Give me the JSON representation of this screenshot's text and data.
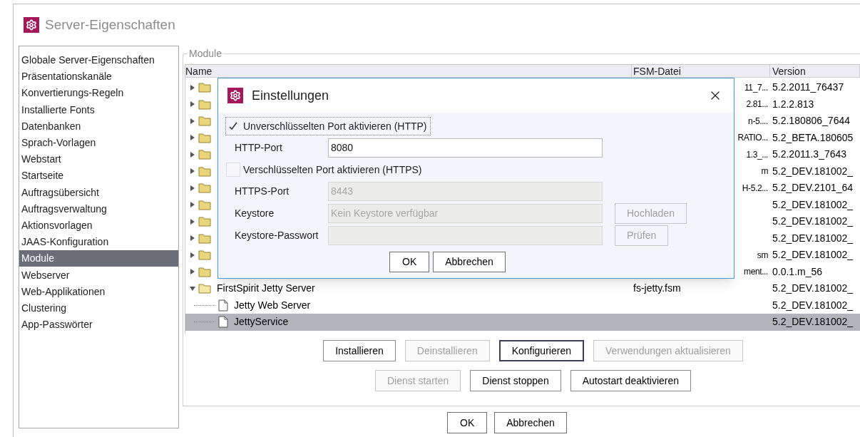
{
  "window": {
    "title": "Server-Eigenschaften"
  },
  "sidebar": {
    "items": [
      {
        "label": "Globale Server-Eigenschaften",
        "selected": false
      },
      {
        "label": "Präsentationskanäle",
        "selected": false
      },
      {
        "label": "Konvertierungs-Regeln",
        "selected": false
      },
      {
        "label": "Installierte Fonts",
        "selected": false
      },
      {
        "label": "Datenbanken",
        "selected": false
      },
      {
        "label": "Sprach-Vorlagen",
        "selected": false
      },
      {
        "label": "Webstart",
        "selected": false
      },
      {
        "label": "Startseite",
        "selected": false
      },
      {
        "label": "Auftragsübersicht",
        "selected": false
      },
      {
        "label": "Auftragsverwaltung",
        "selected": false
      },
      {
        "label": "Aktionsvorlagen",
        "selected": false
      },
      {
        "label": "JAAS-Konfiguration",
        "selected": false
      },
      {
        "label": "Module",
        "selected": true
      },
      {
        "label": "Webserver",
        "selected": false
      },
      {
        "label": "Web-Applikationen",
        "selected": false
      },
      {
        "label": "Clustering",
        "selected": false
      },
      {
        "label": "App-Passwörter",
        "selected": false
      }
    ]
  },
  "module_group": {
    "title": "Module",
    "table": {
      "columns": [
        "Name",
        "FSM-Datei",
        "Version"
      ],
      "rows": [
        {
          "kind": "folder",
          "expanded": false,
          "selected": false,
          "fsm": "11_7...",
          "version": "5.2.2011_76437"
        },
        {
          "kind": "folder",
          "expanded": false,
          "selected": false,
          "fsm": "2.81...",
          "version": "1.2.2.813"
        },
        {
          "kind": "folder",
          "expanded": false,
          "selected": false,
          "fsm": "n-5....",
          "version": "5.2.180806_7644"
        },
        {
          "kind": "folder",
          "expanded": false,
          "selected": false,
          "fsm": "RATIO...",
          "version": "5.2_BETA.180605"
        },
        {
          "kind": "folder",
          "expanded": false,
          "selected": false,
          "fsm": "1.3_...",
          "version": "5.2.2011.3_7643"
        },
        {
          "kind": "folder",
          "expanded": false,
          "selected": false,
          "fsm": "m",
          "version": "5.2_DEV.181002_"
        },
        {
          "kind": "folder",
          "expanded": false,
          "selected": false,
          "fsm": "H-5.2...",
          "version": "5.2_DEV.2101_64"
        },
        {
          "kind": "folder",
          "expanded": false,
          "selected": false,
          "version": "5.2_DEV.181002_"
        },
        {
          "kind": "folder",
          "expanded": false,
          "selected": false,
          "version": "5.2_DEV.181002_"
        },
        {
          "kind": "folder",
          "expanded": false,
          "selected": false,
          "version": "5.2_DEV.181002_"
        },
        {
          "kind": "folder",
          "expanded": false,
          "selected": false,
          "fsm": "sm",
          "version": "5.2_DEV.181002_"
        },
        {
          "kind": "folder",
          "expanded": false,
          "selected": false,
          "fsm": "ment...",
          "version": "0.0.1.m_56"
        },
        {
          "kind": "folder",
          "expanded": true,
          "selected": false,
          "name": "FirstSpirit Jetty Server",
          "fsm": "fs-jetty.fsm",
          "version": "5.2_DEV.181002_",
          "children": [
            {
              "kind": "file",
              "selected": false,
              "name": "Jetty Web Server",
              "version": "5.2_DEV.181002_"
            },
            {
              "kind": "file",
              "selected": true,
              "name": "JettyService",
              "version": "5.2_DEV.181002_"
            }
          ]
        }
      ]
    },
    "button_rows": [
      [
        {
          "label": "Installieren",
          "disabled": false,
          "focused": false
        },
        {
          "label": "Deinstallieren",
          "disabled": true,
          "focused": false
        },
        {
          "label": "Konfigurieren",
          "disabled": false,
          "focused": true
        },
        {
          "label": "Verwendungen aktualisieren",
          "disabled": true,
          "focused": false
        }
      ],
      [
        {
          "label": "Dienst starten",
          "disabled": true,
          "focused": false
        },
        {
          "label": "Dienst stoppen",
          "disabled": false,
          "focused": false
        },
        {
          "label": "Autostart deaktivieren",
          "disabled": false,
          "focused": false
        }
      ]
    ]
  },
  "buttons": [
    "OK",
    "Abbrechen"
  ],
  "dialog": {
    "title": "Einstellungen",
    "rows": [
      {
        "kind": "checkbox",
        "label": "Unverschlüsselten Port aktivieren (HTTP)",
        "checked": true,
        "focused": true
      },
      {
        "kind": "field",
        "label": "HTTP-Port",
        "value": "8080",
        "disabled": false
      },
      {
        "kind": "checkbox",
        "label": "Verschlüsselten Port aktivieren (HTTPS)",
        "checked": false,
        "focused": false
      },
      {
        "kind": "field",
        "label": "HTTPS-Port",
        "value": "8443",
        "disabled": true
      },
      {
        "kind": "field",
        "label": "Keystore",
        "value": "Kein Keystore verfügbar",
        "disabled": true,
        "button": {
          "label": "Hochladen",
          "disabled": true
        }
      },
      {
        "kind": "field",
        "label": "Keystore-Passwort",
        "disabled": true,
        "button": {
          "label": "Prüfen",
          "disabled": true
        }
      }
    ],
    "buttons": [
      "OK",
      "Abbrechen"
    ]
  }
}
